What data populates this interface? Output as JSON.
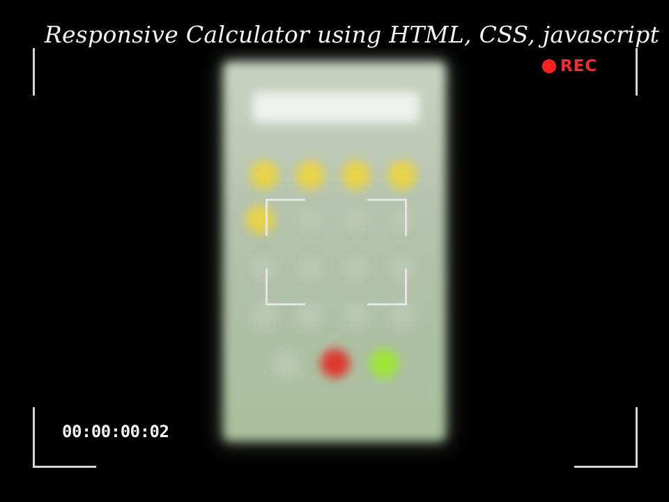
{
  "overlay": {
    "title": "Responsive Calculator using HTML, CSS, javascript",
    "rec_label": "REC",
    "rec_color": "#ff2a2a",
    "timecode": "00:00:00:02"
  },
  "scene": {
    "background_color": "#000000",
    "subject": "blurred-phone-calculator",
    "screen_color": "#eef1ec",
    "operator_key_color": "#e7d24a",
    "number_key_color": "#b9c7b0",
    "delete_key_color": "#dd3a2e",
    "equals_key_color": "#9ee538"
  }
}
